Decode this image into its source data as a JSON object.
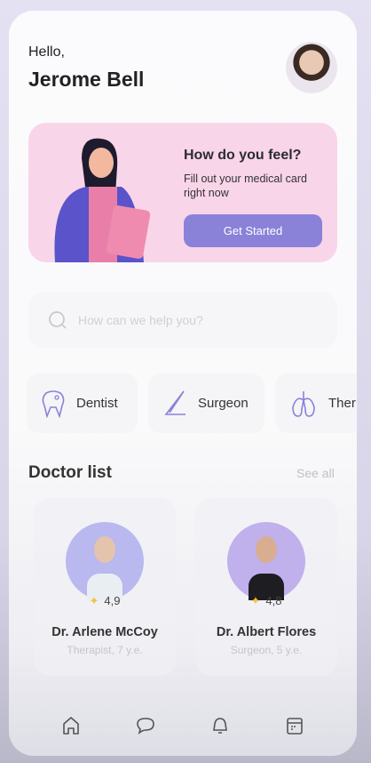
{
  "header": {
    "greeting": "Hello,",
    "user_name": "Jerome Bell"
  },
  "banner": {
    "title": "How do you feel?",
    "subtitle": "Fill out your medical card right now",
    "button": "Get Started"
  },
  "search": {
    "placeholder": "How can we help you?"
  },
  "categories": [
    {
      "label": "Dentist",
      "icon": "tooth-icon"
    },
    {
      "label": "Surgeon",
      "icon": "scalpel-icon"
    },
    {
      "label": "Ther",
      "icon": "lungs-icon"
    }
  ],
  "doctor_list": {
    "title": "Doctor list",
    "see_all": "See all",
    "doctors": [
      {
        "name": "Dr. Arlene McCoy",
        "specialty": "Therapist, 7 y.e.",
        "rating": "4,9"
      },
      {
        "name": "Dr. Albert Flores",
        "specialty": "Surgeon, 5 y.e.",
        "rating": "4,8"
      }
    ]
  },
  "colors": {
    "accent": "#8a82d8",
    "banner": "#f9d5ea"
  }
}
